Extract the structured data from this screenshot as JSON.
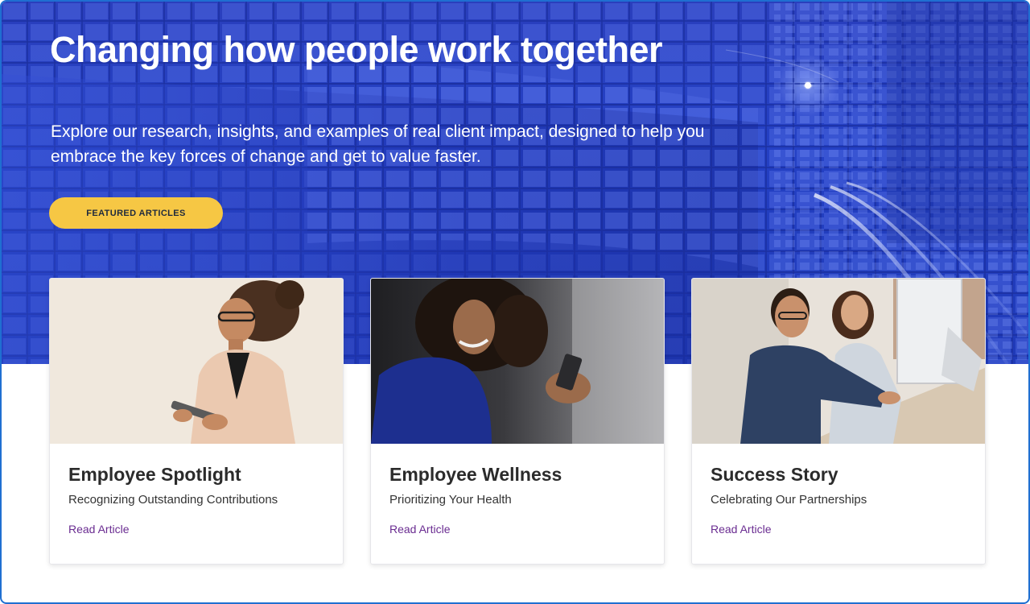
{
  "hero": {
    "title": "Changing how people work together",
    "subtitle": "Explore our research, insights, and examples of real client impact, designed to help you embrace the key forces of change and get to value faster.",
    "button_label": "FEATURED ARTICLES"
  },
  "cards": [
    {
      "title": "Employee Spotlight",
      "subtitle": "Recognizing Outstanding Contributions",
      "link_label": "Read Article"
    },
    {
      "title": "Employee Wellness",
      "subtitle": "Prioritizing Your Health",
      "link_label": "Read Article"
    },
    {
      "title": "Success Story",
      "subtitle": "Celebrating Our Partnerships",
      "link_label": "Read Article"
    }
  ],
  "colors": {
    "hero_blue": "#2440c4",
    "button_yellow": "#f6c744",
    "link_purple": "#6a2c91",
    "frame_border": "#1f6fd1"
  }
}
